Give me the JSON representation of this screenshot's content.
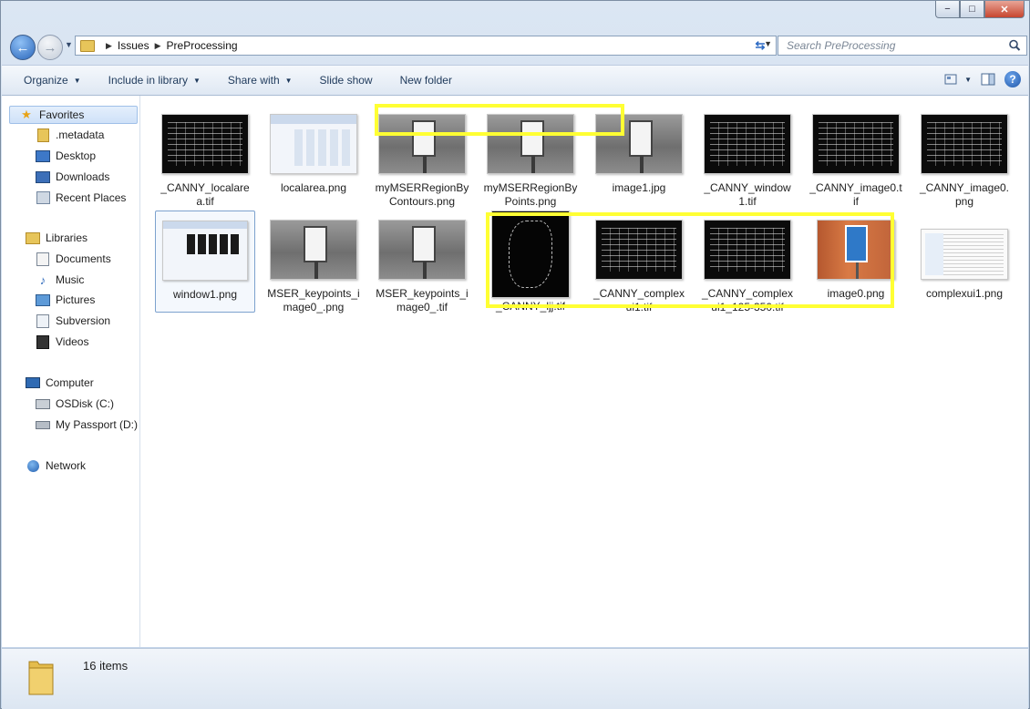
{
  "window": {
    "minimize_glyph": "−",
    "maximize_glyph": "□",
    "close_glyph": "✕"
  },
  "address": {
    "crumbs": [
      "Issues",
      "PreProcessing"
    ]
  },
  "search": {
    "placeholder": "Search PreProcessing"
  },
  "toolbar": {
    "organize": "Organize",
    "include_in_library": "Include in library",
    "share_with": "Share with",
    "slide_show": "Slide show",
    "new_folder": "New folder"
  },
  "nav": {
    "favorites": "Favorites",
    "metadata": ".metadata",
    "desktop": "Desktop",
    "downloads": "Downloads",
    "recent_places": "Recent Places",
    "libraries": "Libraries",
    "documents": "Documents",
    "music": "Music",
    "pictures": "Pictures",
    "subversion": "Subversion",
    "videos": "Videos",
    "computer": "Computer",
    "osdisk": "OSDisk (C:)",
    "my_passport": "My Passport (D:)",
    "network": "Network"
  },
  "files": [
    {
      "name": "_CANNY_localarea.tif",
      "thumb": "black"
    },
    {
      "name": "localarea.png",
      "thumb": "explorer"
    },
    {
      "name": "myMSERRegionByContours.png",
      "thumb": "sign"
    },
    {
      "name": "myMSERRegionByPoints.png",
      "thumb": "sign"
    },
    {
      "name": "image1.jpg",
      "thumb": "sign"
    },
    {
      "name": "_CANNY_window1.tif",
      "thumb": "black"
    },
    {
      "name": "_CANNY_image0.tif",
      "thumb": "black"
    },
    {
      "name": "_CANNY_image0.png",
      "thumb": "black"
    },
    {
      "name": "window1.png",
      "thumb": "explorer2"
    },
    {
      "name": "MSER_keypoints_image0_.png",
      "thumb": "sign"
    },
    {
      "name": "MSER_keypoints_image0_.tif",
      "thumb": "sign"
    },
    {
      "name": "_CANNY_ljj.tif",
      "thumb": "edges"
    },
    {
      "name": "_CANNY_complexui1.tif",
      "thumb": "black"
    },
    {
      "name": "_CANNY_complexui1_125-350.tif",
      "thumb": "black"
    },
    {
      "name": "image0.png",
      "thumb": "sign-blue"
    },
    {
      "name": "complexui1.png",
      "thumb": "code"
    }
  ],
  "status": {
    "count": "16 items"
  },
  "colors": {
    "highlight": "#ffff33",
    "accent": "#1e395b"
  }
}
